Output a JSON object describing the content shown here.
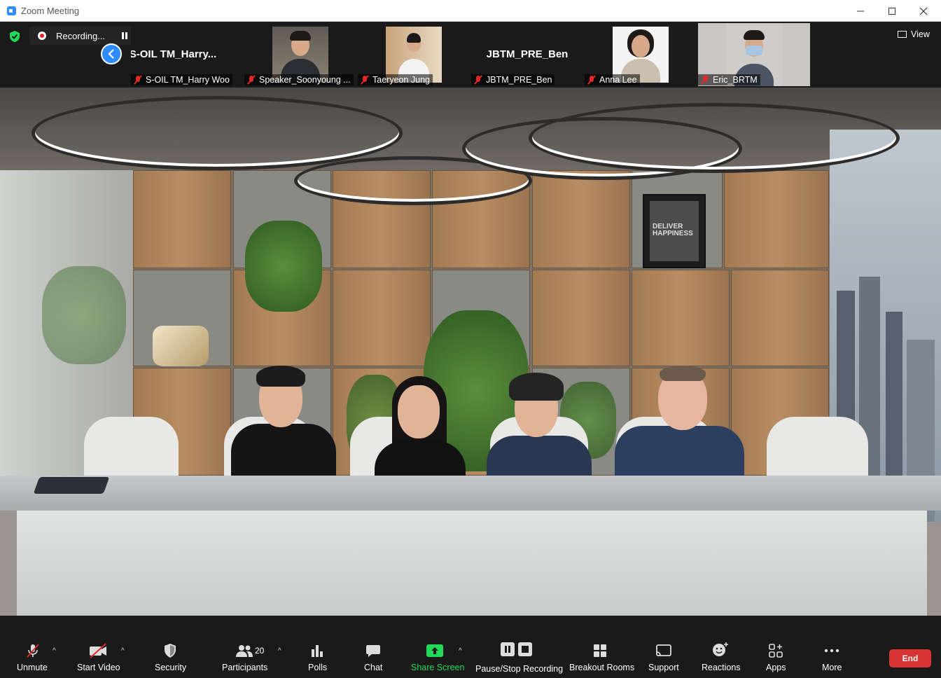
{
  "window": {
    "title": "Zoom Meeting"
  },
  "recording": {
    "status": "Recording..."
  },
  "top_view": {
    "label": "View"
  },
  "participant_tiles": [
    {
      "name_big": "S-OIL  TM_Harry...",
      "label": "S-OIL TM_Harry Woo",
      "video": false
    },
    {
      "label": "Speaker_Soonyoung ...",
      "video": true
    },
    {
      "label": "Taeryeon Jung",
      "video": true
    },
    {
      "name_big": "JBTM_PRE_Ben",
      "label": "JBTM_PRE_Ben",
      "video": false
    },
    {
      "label": "Anna Lee",
      "video": true
    },
    {
      "label": "Eric_BRTM",
      "video": true
    }
  ],
  "main_video": {
    "poster_text": [
      "DELIVER",
      "HAPPINESS"
    ]
  },
  "toolbar": {
    "unmute": "Unmute",
    "start_video": "Start Video",
    "security": "Security",
    "participants": "Participants",
    "participant_count": "20",
    "polls": "Polls",
    "chat": "Chat",
    "share_screen": "Share Screen",
    "pause_stop_recording": "Pause/Stop Recording",
    "breakout_rooms": "Breakout Rooms",
    "support": "Support",
    "reactions": "Reactions",
    "apps": "Apps",
    "more": "More",
    "end": "End"
  },
  "colors": {
    "accent": "#2D8CFF",
    "share_green": "#23D959",
    "end_red": "#D73333",
    "muted_red": "#E02828"
  }
}
